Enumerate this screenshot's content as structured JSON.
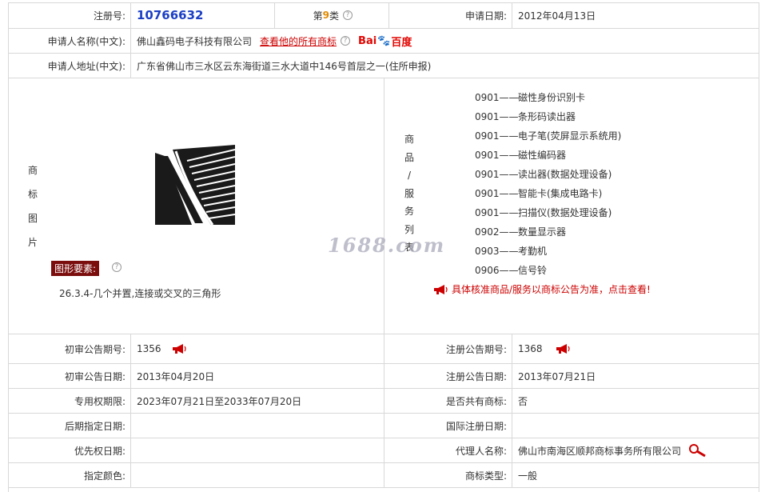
{
  "row1": {
    "reg_label": "注册号:",
    "reg_no": "10766632",
    "class_prefix": "第",
    "class_num": "9",
    "class_suffix": "类",
    "apply_date_label": "申请日期:",
    "apply_date": "2012年04月13日"
  },
  "row2": {
    "applicant_label": "申请人名称(中文):",
    "applicant": "佛山鑫码电子科技有限公司",
    "all_marks_link": "查看他的所有商标",
    "baidu_bai": "Bai",
    "baidu_du": "百度"
  },
  "row3": {
    "address_label": "申请人地址(中文):",
    "address": "广东省佛山市三水区云东海街道三水大道中146号首层之一(住所申报)"
  },
  "image_section": {
    "label_chars": [
      "商",
      "标",
      "图",
      "片"
    ],
    "elements_tag": "图形要素:",
    "elements_desc": "26.3.4-几个并置,连接或交叉的三角形"
  },
  "goods_section": {
    "label_chars": [
      "商",
      "品",
      "/",
      "服",
      "务",
      "列",
      "表"
    ],
    "items": [
      {
        "code": "0901——",
        "name": "磁性身份识别卡"
      },
      {
        "code": "0901——",
        "name": "条形码读出器"
      },
      {
        "code": "0901——",
        "name": "电子笔(荧屏显示系统用)"
      },
      {
        "code": "0901——",
        "name": "磁性编码器"
      },
      {
        "code": "0901——",
        "name": "读出器(数据处理设备)"
      },
      {
        "code": "0901——",
        "name": "智能卡(集成电路卡)"
      },
      {
        "code": "0901——",
        "name": "扫描仪(数据处理设备)"
      },
      {
        "code": "0902——",
        "name": "数量显示器"
      },
      {
        "code": "0903——",
        "name": "考勤机"
      },
      {
        "code": "0906——",
        "name": "信号铃"
      }
    ],
    "notice": "具体核准商品/服务以商标公告为准，点击查看!"
  },
  "watermark": "1688.com",
  "details": {
    "prelim_no_label": "初审公告期号:",
    "prelim_no": "1356",
    "reg_pub_no_label": "注册公告期号:",
    "reg_pub_no": "1368",
    "prelim_date_label": "初审公告日期:",
    "prelim_date": "2013年04月20日",
    "reg_pub_date_label": "注册公告日期:",
    "reg_pub_date": "2013年07月21日",
    "exclusive_label": "专用权期限:",
    "exclusive": "2023年07月21日至2033年07月20日",
    "shared_label": "是否共有商标:",
    "shared": "否",
    "later_date_label": "后期指定日期:",
    "later_date": "",
    "intl_date_label": "国际注册日期:",
    "intl_date": "",
    "priority_label": "优先权日期:",
    "priority": "",
    "agent_label": "代理人名称:",
    "agent": "佛山市南海区顺邦商标事务所有限公司",
    "color_label": "指定颜色:",
    "color": "",
    "type_label": "商标类型:",
    "type": "一般"
  },
  "colors": {
    "reg_no": "#1c3fc4",
    "accent_red": "#cc0000",
    "elements_tag_bg": "#7b0d0d"
  }
}
